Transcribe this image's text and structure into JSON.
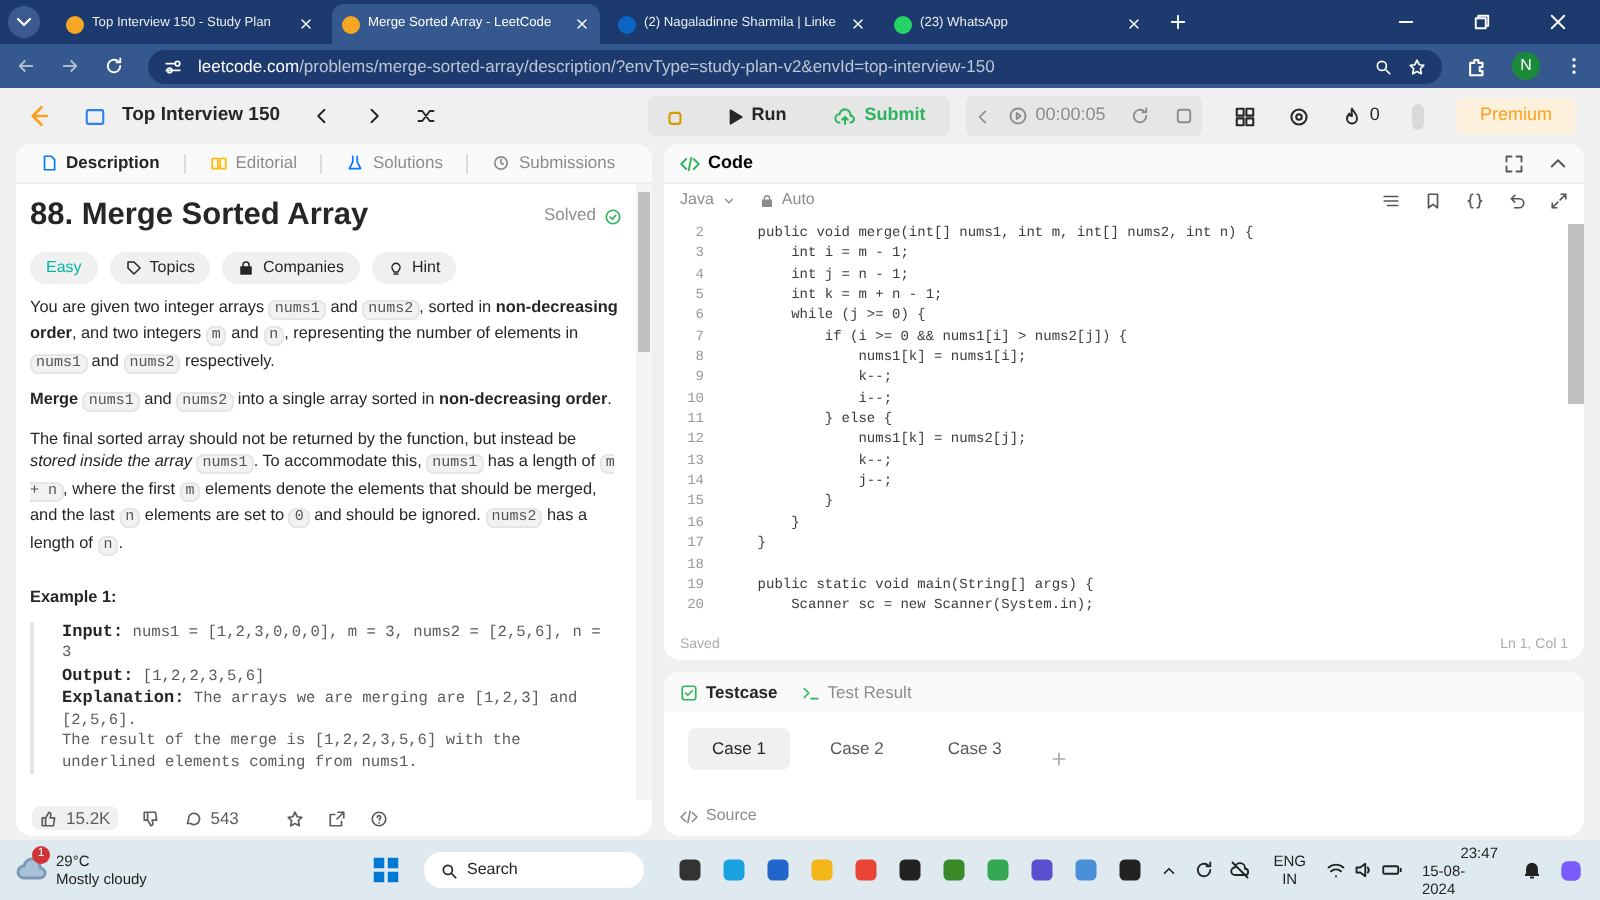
{
  "browser_tabs": [
    {
      "title": "Top Interview 150 - Study Plan",
      "selected": false
    },
    {
      "title": "Merge Sorted Array - LeetCode",
      "selected": true
    },
    {
      "title": "(2) Nagaladinne Sharmila | Linke",
      "selected": false
    },
    {
      "title": "(23) WhatsApp",
      "selected": false
    }
  ],
  "address_bar": {
    "host": "leetcode.com",
    "path": "/problems/merge-sorted-array/description/?envType=study-plan-v2&envId=top-interview-150"
  },
  "profile_initial": "N",
  "nav": {
    "study_plan": "Top Interview 150",
    "run": "Run",
    "submit": "Submit",
    "timer": "00:00:05",
    "streak": "0",
    "premium": "Premium"
  },
  "left_tabs": [
    {
      "label": "Description",
      "selected": true
    },
    {
      "label": "Editorial",
      "selected": false
    },
    {
      "label": "Solutions",
      "selected": false
    },
    {
      "label": "Submissions",
      "selected": false
    }
  ],
  "problem": {
    "title": "88. Merge Sorted Array",
    "status": "Solved",
    "difficulty": "Easy",
    "tags": [
      "Topics",
      "Companies",
      "Hint"
    ],
    "paragraphs": [
      [
        {
          "kind": "text",
          "text": "You are given two integer arrays "
        },
        {
          "kind": "code",
          "text": "nums1"
        },
        {
          "kind": "text",
          "text": " and "
        },
        {
          "kind": "code",
          "text": "nums2"
        },
        {
          "kind": "text",
          "text": ", sorted in "
        },
        {
          "kind": "bold",
          "text": "non-decreasing order"
        },
        {
          "kind": "text",
          "text": ", and two integers "
        },
        {
          "kind": "code",
          "text": "m"
        },
        {
          "kind": "text",
          "text": " and "
        },
        {
          "kind": "code",
          "text": "n"
        },
        {
          "kind": "text",
          "text": ", representing the number of elements in "
        },
        {
          "kind": "code",
          "text": "nums1"
        },
        {
          "kind": "text",
          "text": " and "
        },
        {
          "kind": "code",
          "text": "nums2"
        },
        {
          "kind": "text",
          "text": " respectively."
        }
      ],
      [
        {
          "kind": "bold",
          "text": "Merge "
        },
        {
          "kind": "code",
          "text": "nums1"
        },
        {
          "kind": "text",
          "text": " and "
        },
        {
          "kind": "code",
          "text": "nums2"
        },
        {
          "kind": "text",
          "text": " into a single array sorted in "
        },
        {
          "kind": "bold",
          "text": "non-decreasing order"
        },
        {
          "kind": "text",
          "text": "."
        }
      ],
      [
        {
          "kind": "text",
          "text": "The final sorted array should not be returned by the function, but instead be "
        },
        {
          "kind": "italic",
          "text": "stored inside the array "
        },
        {
          "kind": "code",
          "text": "nums1"
        },
        {
          "kind": "text",
          "text": ". To accommodate this, "
        },
        {
          "kind": "code",
          "text": "nums1"
        },
        {
          "kind": "text",
          "text": " has a length of "
        },
        {
          "kind": "code",
          "text": "m + n"
        },
        {
          "kind": "text",
          "text": ", where the first "
        },
        {
          "kind": "code",
          "text": "m"
        },
        {
          "kind": "text",
          "text": " elements denote the elements that should be merged, and the last "
        },
        {
          "kind": "code",
          "text": "n"
        },
        {
          "kind": "text",
          "text": " elements are set to "
        },
        {
          "kind": "code",
          "text": "0"
        },
        {
          "kind": "text",
          "text": " and should be ignored. "
        },
        {
          "kind": "code",
          "text": "nums2"
        },
        {
          "kind": "text",
          "text": " has a length of "
        },
        {
          "kind": "code",
          "text": "n"
        },
        {
          "kind": "text",
          "text": "."
        }
      ]
    ],
    "example_title": "Example 1:",
    "example_lines": [
      {
        "label": "Input:",
        "text": "nums1 = [1,2,3,0,0,0], m = 3, nums2 = [2,5,6], n = 3"
      },
      {
        "label": "Output:",
        "text": "[1,2,2,3,5,6]"
      },
      {
        "label": "Explanation:",
        "text": "The arrays we are merging are [1,2,3] and [2,5,6]."
      },
      {
        "text": "The result of the merge is [1,2,2,3,5,6] with the underlined elements coming from nums1."
      }
    ]
  },
  "footer": {
    "likes": "15.2K",
    "comments": "543"
  },
  "code_panel": {
    "title": "Code",
    "language": "Java",
    "mode": "Auto",
    "lines": [
      {
        "number": "2",
        "text": "    public void merge(int[] nums1, int m, int[] nums2, int n) {"
      },
      {
        "number": "3",
        "text": "        int i = m - 1;"
      },
      {
        "number": "4",
        "text": "        int j = n - 1;"
      },
      {
        "number": "5",
        "text": "        int k = m + n - 1;"
      },
      {
        "number": "6",
        "text": "        while (j >= 0) {"
      },
      {
        "number": "7",
        "text": "            if (i >= 0 && nums1[i] > nums2[j]) {"
      },
      {
        "number": "8",
        "text": "                nums1[k] = nums1[i];"
      },
      {
        "number": "9",
        "text": "                k--;"
      },
      {
        "number": "10",
        "text": "                i--;"
      },
      {
        "number": "11",
        "text": "            } else {"
      },
      {
        "number": "12",
        "text": "                nums1[k] = nums2[j];"
      },
      {
        "number": "13",
        "text": "                k--;"
      },
      {
        "number": "14",
        "text": "                j--;"
      },
      {
        "number": "15",
        "text": "            }"
      },
      {
        "number": "16",
        "text": "        }"
      },
      {
        "number": "17",
        "text": "    }"
      },
      {
        "number": "18"
      },
      {
        "number": "19",
        "text": "    public static void main(String[] args) {"
      },
      {
        "number": "20",
        "text": "        Scanner sc = new Scanner(System.in);"
      }
    ],
    "saved": "Saved",
    "cursor": "Ln 1, Col 1"
  },
  "test_panel": {
    "tabs": [
      {
        "label": "Testcase",
        "selected": true
      },
      {
        "label": "Test Result",
        "selected": false
      }
    ],
    "cases": [
      {
        "label": "Case 1",
        "selected": true
      },
      {
        "label": "Case 2",
        "selected": false
      },
      {
        "label": "Case 3",
        "selected": false
      }
    ],
    "source": "Source"
  },
  "taskbar": {
    "temperature": "29°C",
    "weather": "Mostly cloudy",
    "weather_badge": "1",
    "search": "Search",
    "language": "ENG",
    "region": "IN",
    "time": "23:47",
    "date": "15-08-2024"
  }
}
